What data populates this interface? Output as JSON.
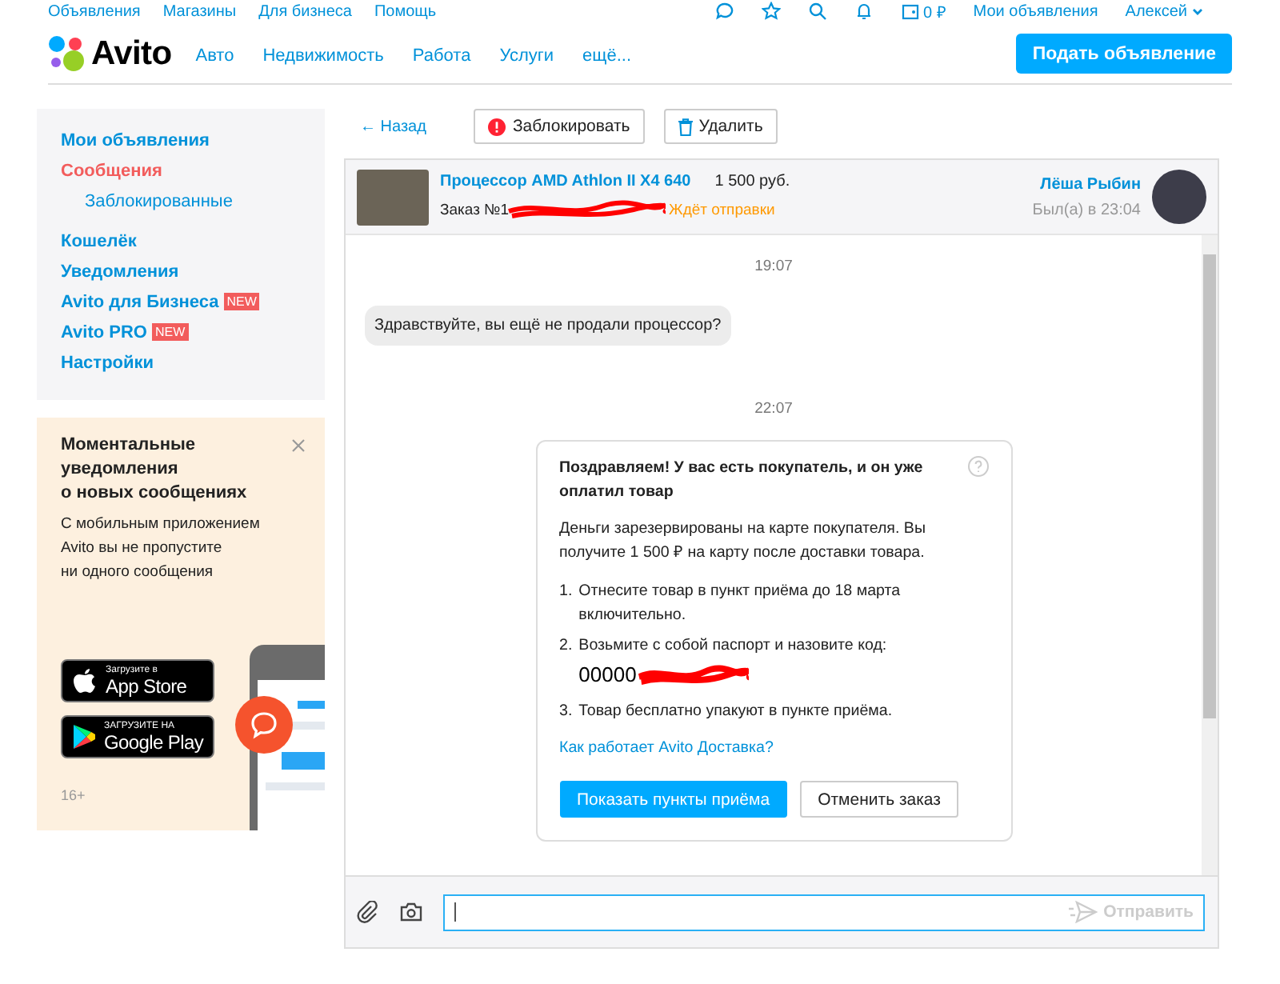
{
  "top_bar": {
    "links": [
      "Объявления",
      "Магазины",
      "Для бизнеса",
      "Помощь"
    ],
    "balance": "0 ₽",
    "my_ads": "Мои объявления",
    "user": "Алексей"
  },
  "header": {
    "logo": "Avito",
    "nav": [
      "Авто",
      "Недвижимость",
      "Работа",
      "Услуги",
      "ещё..."
    ],
    "post_button": "Подать объявление"
  },
  "sidebar": {
    "items": [
      {
        "label": "Мои объявления",
        "selected": false
      },
      {
        "label": "Сообщения",
        "selected": true,
        "children": [
          {
            "label": "Заблокированные",
            "selected": false
          }
        ]
      },
      {
        "label": "Кошелёк",
        "selected": false
      },
      {
        "label": "Уведомления",
        "selected": false
      },
      {
        "label": "Avito для Бизнеса",
        "selected": false,
        "badge": "NEW"
      },
      {
        "label": "Avito PRO",
        "selected": false,
        "badge": "NEW"
      },
      {
        "label": "Настройки",
        "selected": false
      }
    ]
  },
  "promo": {
    "title_lines": [
      "Моментальные",
      "уведомления",
      "о новых сообщениях"
    ],
    "text_lines": [
      "С мобильным приложением",
      "Avito вы не пропустите",
      "ни одного сообщения"
    ],
    "app_store": {
      "caption": "Загрузите в",
      "name": "App Store"
    },
    "google_play": {
      "caption": "ЗАГРУЗИТЕ НА",
      "name": "Google Play"
    },
    "age": "16+"
  },
  "toolbar": {
    "back": "← Назад",
    "block": "Заблокировать",
    "delete": "Удалить"
  },
  "chat_header": {
    "product": "Процессор AMD Athlon II X4 640",
    "price": "1 500 руб.",
    "order": "Заказ №1",
    "status": "Ждёт отправки",
    "user": "Лёша Рыбин",
    "last_seen": "Был(а) в 23:04"
  },
  "messages": [
    {
      "kind": "time",
      "text": "19:07"
    },
    {
      "kind": "incoming",
      "text": "Здравствуйте,  вы ещё не продали процессор?"
    },
    {
      "kind": "time",
      "text": "22:07"
    },
    {
      "kind": "delivery",
      "title": "Поздравляем! У вас есть покупатель, и он уже оплатил товар",
      "text": "Деньги зарезервированы на карте покупателя. Вы получите 1 500 ₽ на карту после доставки товара.",
      "steps": [
        {
          "number": "1.",
          "text": "Отнесите товар в пункт приёма до 18 марта включительно."
        },
        {
          "number": "2.",
          "text": "Возьмите с собой паспорт и назовите код:",
          "code": "00000"
        },
        {
          "number": "3.",
          "text": "Товар бесплатно упакуют в пункте приёма."
        }
      ],
      "link": "Как работает Avito Доставка?",
      "primary_button": "Показать пункты приёма",
      "secondary_button": "Отменить заказ"
    }
  ],
  "composer": {
    "send": "Отправить"
  }
}
